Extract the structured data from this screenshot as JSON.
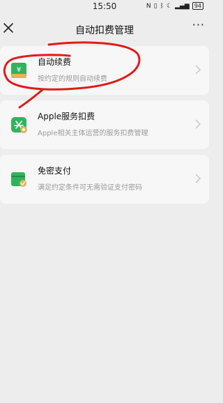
{
  "status_bar": {
    "time": "15:50",
    "icons": [
      "nfc-icon",
      "vibrate-icon",
      "bluetooth-icon",
      "do-not-disturb-icon",
      "signal-icon"
    ],
    "battery": "94"
  },
  "nav": {
    "title": "自动扣费管理",
    "more": "···"
  },
  "cards": [
    {
      "title": "自动续费",
      "desc": "按约定的规则自动续费",
      "icon": "wallet-yen-icon"
    },
    {
      "title": "Apple服务扣费",
      "desc": "Apple相关主体运营的服务扣费管理",
      "icon": "apple-store-icon"
    },
    {
      "title": "免密支付",
      "desc": "满足约定条件可无需验证支付密码",
      "icon": "wallet-check-icon"
    }
  ],
  "colors": {
    "accent_green": "#2fb45d",
    "annotation_red": "#e01b1b"
  }
}
